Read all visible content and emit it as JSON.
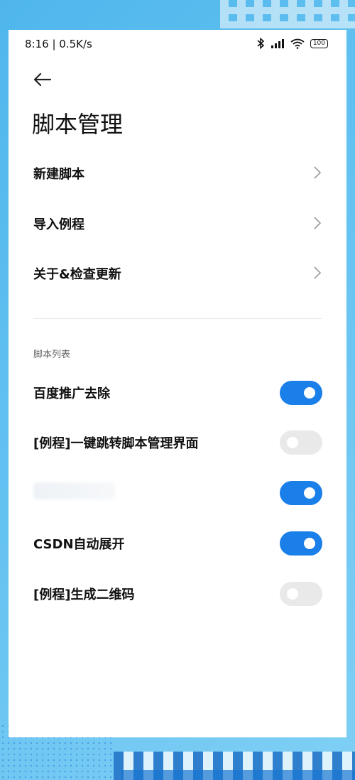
{
  "status": {
    "time": "8:16 | 0.5K/s",
    "battery": "100",
    "icons": [
      "bluetooth-icon",
      "signal-icon",
      "wifi-icon",
      "battery-icon"
    ]
  },
  "header": {
    "back_icon": "arrow-left-icon",
    "title": "脚本管理"
  },
  "menu": [
    {
      "label": "新建脚本",
      "icon": "chevron-right-icon"
    },
    {
      "label": "导入例程",
      "icon": "chevron-right-icon"
    },
    {
      "label": "关于&检查更新",
      "icon": "chevron-right-icon"
    }
  ],
  "script_list": {
    "section_label": "脚本列表",
    "items": [
      {
        "label": "百度推广去除",
        "enabled": true
      },
      {
        "label": "[例程]一键跳转脚本管理界面",
        "enabled": false
      },
      {
        "label": "",
        "enabled": true
      },
      {
        "label": "CSDN自动展开",
        "enabled": true
      },
      {
        "label": "[例程]生成二维码",
        "enabled": false
      }
    ]
  },
  "colors": {
    "accent": "#1a7fe8",
    "toggle_off": "#e9e9e9"
  }
}
